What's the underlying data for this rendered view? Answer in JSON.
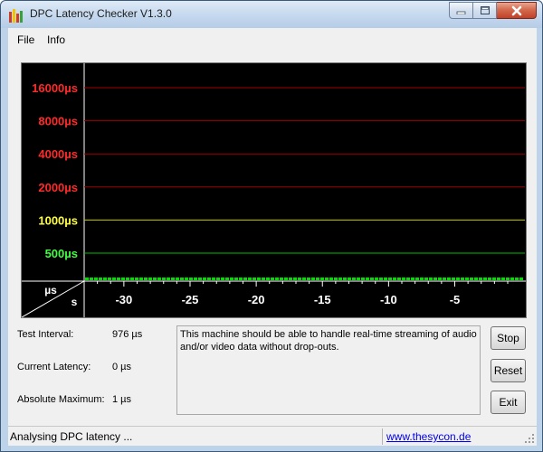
{
  "window": {
    "title": "DPC Latency Checker V1.3.0"
  },
  "icons": {
    "app": "bar-chart-icon",
    "minimize": "minimize-icon",
    "maximize": "maximize-icon",
    "close": "close-icon",
    "grip": "resize-grip-icon"
  },
  "menu": {
    "items": [
      "File",
      "Info"
    ]
  },
  "graph": {
    "y_levels": [
      {
        "label": "16000µs",
        "value": 16000,
        "color": "#ff2a2a",
        "line": "#a00000"
      },
      {
        "label": "8000µs",
        "value": 8000,
        "color": "#ff2a2a",
        "line": "#a00000"
      },
      {
        "label": "4000µs",
        "value": 4000,
        "color": "#ff2a2a",
        "line": "#a00000"
      },
      {
        "label": "2000µs",
        "value": 2000,
        "color": "#ff2a2a",
        "line": "#a00000"
      },
      {
        "label": "1000µs",
        "value": 1000,
        "color": "#ffff40",
        "line": "#c8c800"
      },
      {
        "label": "500µs",
        "value": 500,
        "color": "#40ff40",
        "line": "#00c000"
      }
    ],
    "x_ticks": [
      {
        "label": "-30",
        "value": -30
      },
      {
        "label": "-25",
        "value": -25
      },
      {
        "label": "-20",
        "value": -20
      },
      {
        "label": "-15",
        "value": -15
      },
      {
        "label": "-10",
        "value": -10
      },
      {
        "label": "-5",
        "value": -5
      }
    ],
    "corner_y_unit": "µs",
    "corner_x_unit": "s",
    "bar_color": "#00e000"
  },
  "stats": {
    "test_interval_label": "Test Interval:",
    "test_interval_value": "976 µs",
    "current_latency_label": "Current Latency:",
    "current_latency_value": "0 µs",
    "absolute_maximum_label": "Absolute Maximum:",
    "absolute_maximum_value": "1 µs"
  },
  "message": "This machine should be able to handle real-time streaming of audio and/or video data without drop-outs.",
  "buttons": {
    "stop": "Stop",
    "reset": "Reset",
    "exit": "Exit"
  },
  "status": {
    "text": "Analysing DPC latency ...",
    "link": "www.thesycon.de"
  }
}
